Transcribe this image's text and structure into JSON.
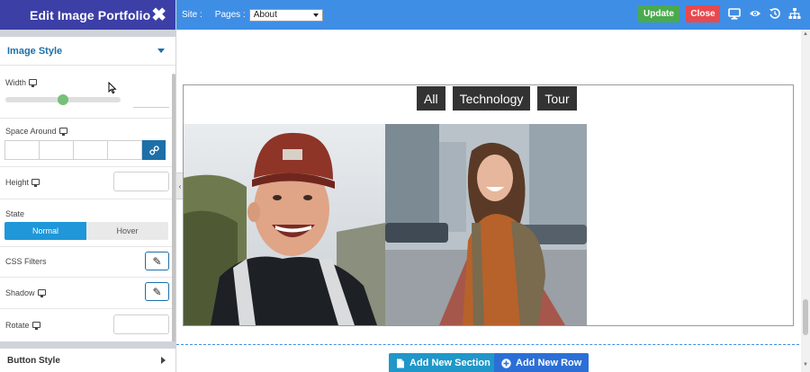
{
  "panel": {
    "title": "Edit Image Portfolio",
    "close_glyph": "✖",
    "section_title": "Image Style",
    "width_label": "Width",
    "width_value": 0.5,
    "space_around_label": "Space Around",
    "link_glyph": "🔗",
    "height_label": "Height",
    "state_label": "State",
    "state_options": [
      "Normal",
      "Hover"
    ],
    "state_selected": "Normal",
    "css_filters_label": "CSS Filters",
    "shadow_label": "Shadow",
    "rotate_label": "Rotate",
    "pencil_glyph": "✎",
    "collapse_glyph": "‹",
    "button_style_label": "Button Style"
  },
  "toolbar": {
    "site_label": "Site :",
    "pages_label": "Pages :",
    "pages_selected": "About",
    "update_label": "Update",
    "close_label": "Close",
    "icons": [
      "desktop-icon",
      "eye-icon",
      "history-icon",
      "sitemap-icon"
    ]
  },
  "portfolio": {
    "filters": [
      "All",
      "Technology",
      "Tour"
    ],
    "photos": [
      "selfie-man-beanie",
      "woman-backpack-street"
    ]
  },
  "canvas": {
    "add_section_label": "Add New Section",
    "add_row_label": "Add New Row"
  },
  "colors": {
    "panel_header": "#3c3fa6",
    "toolbar": "#3f8ee6",
    "update": "#4aaa4e",
    "close": "#e74a4e",
    "accent": "#1f97d8"
  }
}
